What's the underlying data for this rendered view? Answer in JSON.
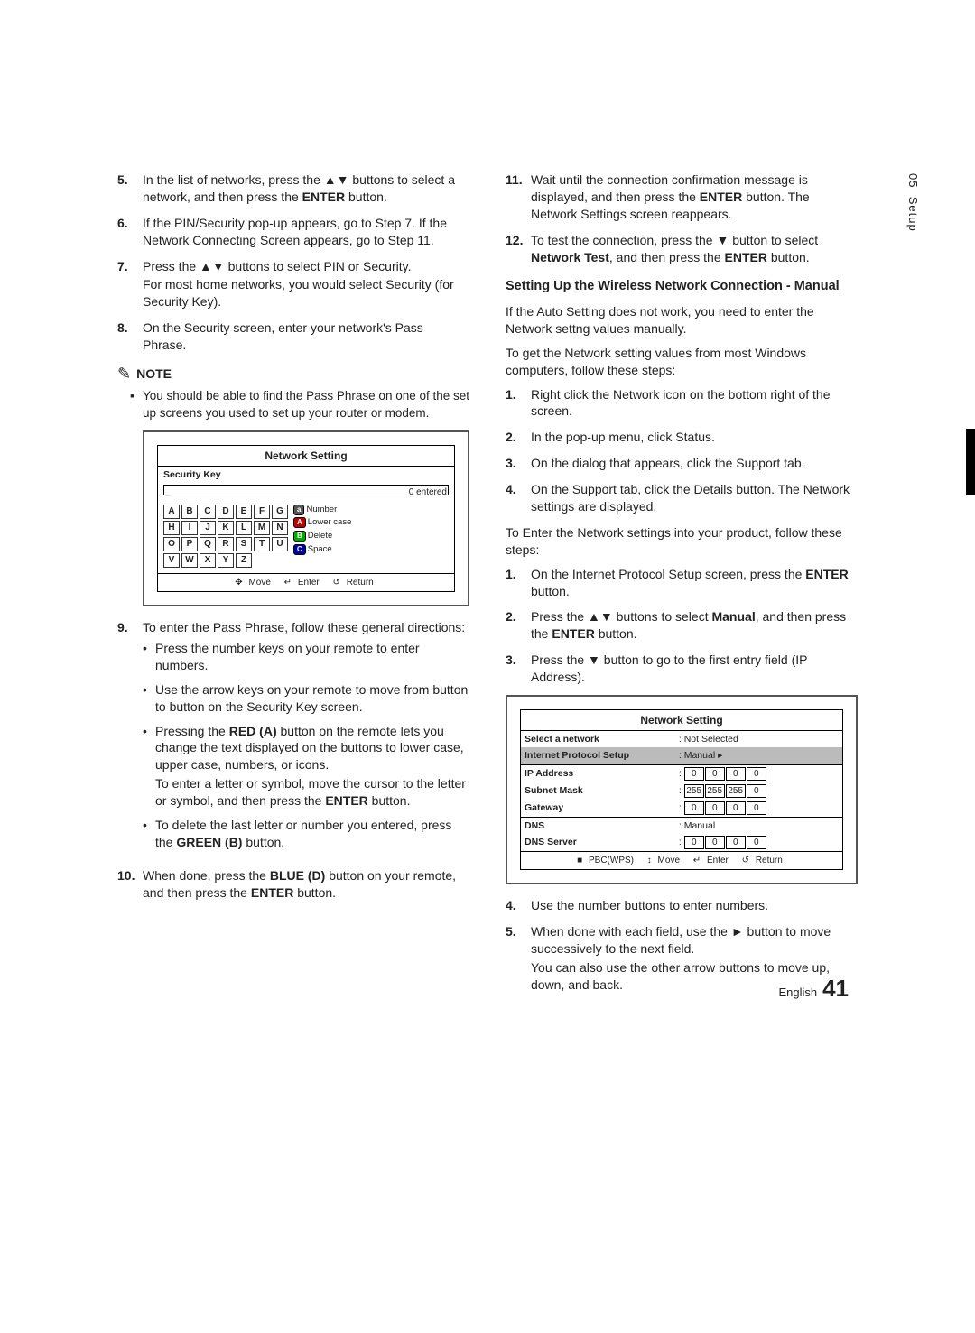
{
  "sidebar": {
    "chapter": "05",
    "title": "Setup"
  },
  "footer": {
    "lang": "English",
    "page": "41"
  },
  "left": {
    "steps_a": [
      {
        "n": "5.",
        "pre": "In the list of networks, press the ",
        "sym": "▲▼",
        "post": " buttons to select a network, and then press the ",
        "b": "ENTER",
        "tail": " button."
      },
      {
        "n": "6.",
        "text": "If the PIN/Security pop-up appears, go to Step 7. If the Network Connecting Screen appears, go to Step 11."
      },
      {
        "n": "7.",
        "pre": "Press the ",
        "sym": "▲▼",
        "post": " buttons to select PIN or Security.",
        "sub": "For most home networks, you would select Security (for Security Key)."
      },
      {
        "n": "8.",
        "text": "On the Security screen, enter your network's Pass Phrase."
      }
    ],
    "note_label": "NOTE",
    "note_text": "You should be able to find the Pass Phrase on one of the set up screens you used to set up your router or modem.",
    "fig1": {
      "title": "Network Setting",
      "subtitle": "Security Key",
      "status": "0 entered",
      "input": "_",
      "keys": [
        "A",
        "B",
        "C",
        "D",
        "E",
        "F",
        "G",
        "H",
        "I",
        "J",
        "K",
        "L",
        "M",
        "N",
        "O",
        "P",
        "Q",
        "R",
        "S",
        "T",
        "U",
        "V",
        "W",
        "X",
        "Y",
        "Z"
      ],
      "side": [
        "Number",
        "Lower case",
        "Delete",
        "Space"
      ],
      "foot": {
        "move": "Move",
        "enter": "Enter",
        "return": "Return"
      }
    },
    "step9": {
      "n": "9.",
      "text": "To enter the Pass Phrase, follow these general directions:"
    },
    "bullets": [
      "Press the number keys on your remote to enter numbers.",
      "Use the arrow keys on your remote to move from button to button on the Security Key screen."
    ],
    "bullet3_a": "Pressing the ",
    "bullet3_b": "RED (A)",
    "bullet3_c": " button on the remote lets you change the text displayed on the buttons to lower case, upper case, numbers, or icons.",
    "bullet3_sub": "To enter a letter or symbol, move the cursor to the letter or symbol, and then press the ",
    "bullet3_sub_b": "ENTER",
    "bullet3_sub_c": " button.",
    "bullet4_a": "To delete the last letter or number you entered, press the ",
    "bullet4_b": "GREEN (B)",
    "bullet4_c": " button.",
    "step10_a": "When done, press the ",
    "step10_b": "BLUE (D)",
    "step10_c": " button on your remote, and then press the ",
    "step10_d": "ENTER",
    "step10_e": " button.",
    "step10_n": "10."
  },
  "right": {
    "step11_n": "11.",
    "step11_a": "Wait until the connection confirmation message is displayed, and then press the ",
    "step11_b": "ENTER",
    "step11_c": " button. The Network Settings screen reappears.",
    "step12_n": "12.",
    "step12_a": "To test the connection, press the ",
    "step12_sym": "▼",
    "step12_b": " button to select ",
    "step12_c": "Network Test",
    "step12_d": ", and then press the ",
    "step12_e": "ENTER",
    "step12_f": " button.",
    "heading": "Setting Up the Wireless Network Connection - Manual",
    "para1": "If the Auto Setting does not work, you need to enter the Network settng values manually.",
    "para2": "To get the Network setting values from most Windows computers, follow these steps:",
    "steps_b": [
      {
        "n": "1.",
        "text": "Right click the Network icon on the bottom right of the screen."
      },
      {
        "n": "2.",
        "text": "In the pop-up menu, click Status."
      },
      {
        "n": "3.",
        "text": "On the dialog that appears, click the Support tab."
      },
      {
        "n": "4.",
        "text": "On the Support tab, click the Details button. The Network settings are displayed."
      }
    ],
    "para3": "To Enter the Network settings into your product, follow these steps:",
    "steps_c1_n": "1.",
    "steps_c1_a": "On the Internet Protocol Setup screen, press the ",
    "steps_c1_b": "ENTER",
    "steps_c1_c": " button.",
    "steps_c2_n": "2.",
    "steps_c2_a": "Press the ",
    "steps_c2_sym": "▲▼",
    "steps_c2_b": " buttons to select ",
    "steps_c2_c": "Manual",
    "steps_c2_d": ", and then press the ",
    "steps_c2_e": "ENTER",
    "steps_c2_f": " button.",
    "steps_c3_n": "3.",
    "steps_c3_a": "Press the ",
    "steps_c3_sym": "▼",
    "steps_c3_b": " button to go to the first entry field (IP Address).",
    "fig2": {
      "title": "Network Setting",
      "rows": [
        {
          "label": "Select a network",
          "val": ": Not Selected"
        },
        {
          "label": "Internet Protocol Setup",
          "val": ": Manual",
          "arrow": "▸"
        },
        {
          "label": "IP Address",
          "ip": [
            "0",
            "0",
            "0",
            "0"
          ]
        },
        {
          "label": "Subnet Mask",
          "ip": [
            "255",
            "255",
            "255",
            "0"
          ]
        },
        {
          "label": "Gateway",
          "ip": [
            "0",
            "0",
            "0",
            "0"
          ]
        },
        {
          "label": "DNS",
          "val": ": Manual"
        },
        {
          "label": "DNS Server",
          "ip": [
            "0",
            "0",
            "0",
            "0"
          ]
        }
      ],
      "foot": {
        "pbc": "PBC(WPS)",
        "move": "Move",
        "enter": "Enter",
        "return": "Return"
      }
    },
    "step4": {
      "n": "4.",
      "text": "Use the number buttons to enter numbers."
    },
    "step5_n": "5.",
    "step5_a": "When done with each field, use the ",
    "step5_sym": "►",
    "step5_b": " button to move successively to the next field.",
    "step5_sub": "You can also use the other arrow buttons to move up, down, and back."
  }
}
